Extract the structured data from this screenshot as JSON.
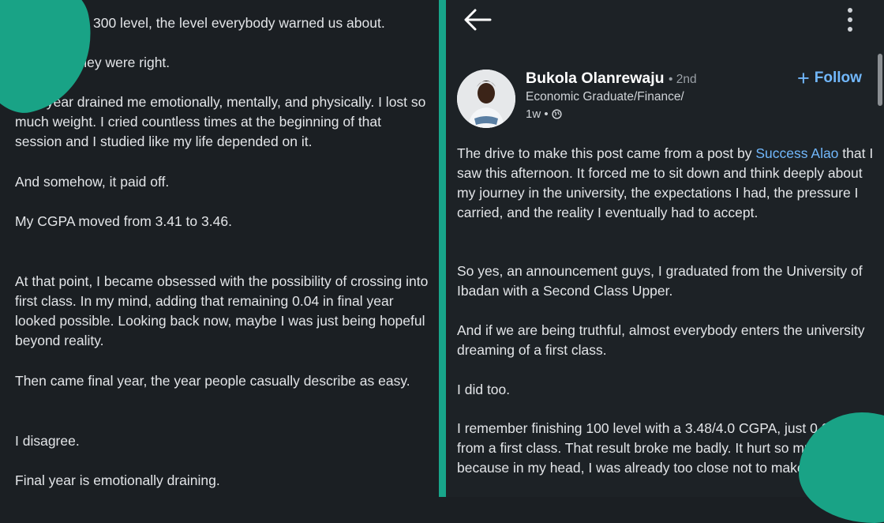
{
  "left": {
    "paragraphs": [
      "300 level, the level everybody warned us about.",
      "Honestly, they were right.",
      "That year drained me emotionally, mentally, and physically. I lost so much weight. I cried countless times at the beginning of that session and I studied like my life depended on it.",
      "And somehow, it paid off.",
      "My CGPA moved from 3.41 to 3.46.",
      "At that point, I became obsessed with the possibility of crossing into first class. In my mind, adding that remaining 0.04 in final year looked possible. Looking back now, maybe I was just being hopeful beyond reality.",
      "Then came final year, the year people casually describe as easy.",
      "I disagree.",
      "Final year is emotionally draining."
    ]
  },
  "post": {
    "author": "Bukola Olanrewaju",
    "degree": "• 2nd",
    "headline": "Economic Graduate/Finance/",
    "age": "1w •",
    "follow_label": "Follow",
    "intro_text": "The drive to make this post came from a post by ",
    "mention": "Success Alao",
    "intro_rest": " that I saw this afternoon. It forced me to sit down and think deeply about my journey in the university, the expectations I had, the pressure I carried, and the reality I eventually had to accept.",
    "paragraphs": [
      "So yes, an announcement guys, I graduated from the University of Ibadan with a Second Class Upper.",
      "And if we are being truthful, almost everybody enters the university dreaming of a first class.",
      "I did too.",
      "I remember finishing 100 level with a 3.48/4.0 CGPA, just 0.02 away from a first class. That result broke me badly. It hurt so much because in my head, I was already too close not to make it."
    ]
  },
  "colors": {
    "accent": "#19a386",
    "link": "#71b7fb",
    "background": "#1b1f23"
  },
  "icons": {
    "back": "back-arrow-icon",
    "more": "more-vertical-icon",
    "globe": "globe-icon",
    "plus": "plus-icon"
  }
}
